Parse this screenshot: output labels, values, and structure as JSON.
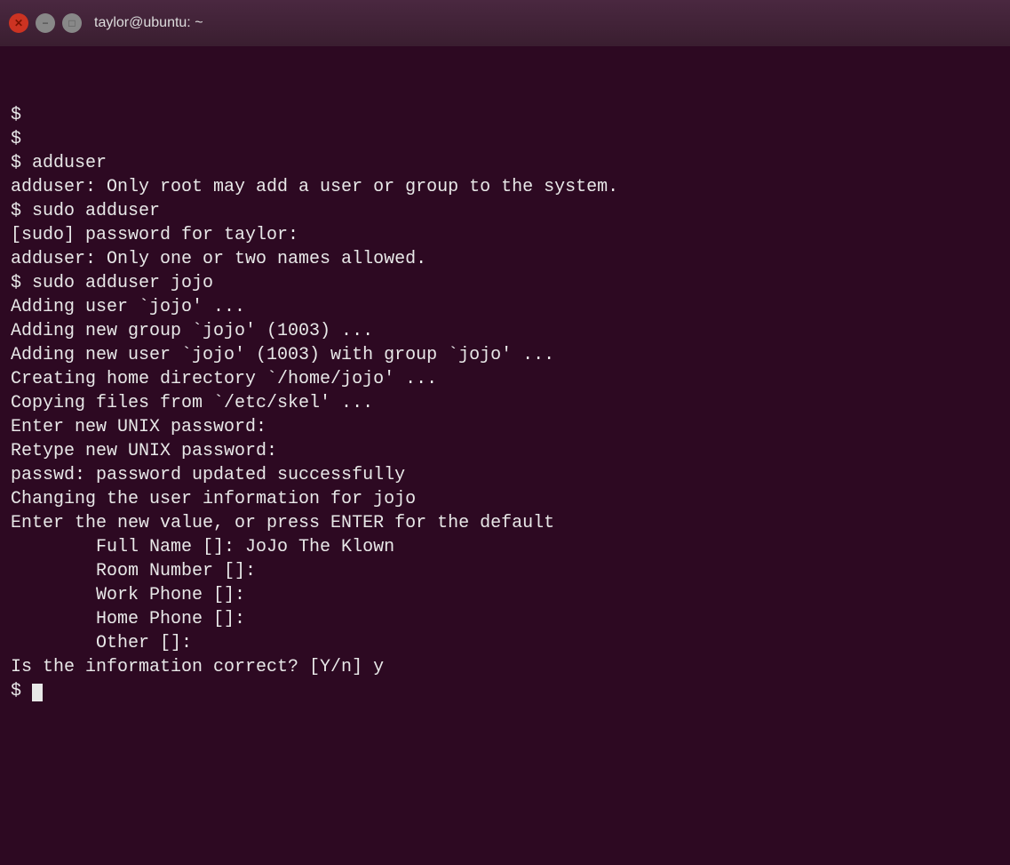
{
  "window": {
    "title": "taylor@ubuntu: ~",
    "buttons": {
      "close": "×",
      "minimize": "−",
      "maximize": "□"
    }
  },
  "terminal": {
    "lines": [
      "$",
      "$",
      "$ adduser",
      "adduser: Only root may add a user or group to the system.",
      "$ sudo adduser",
      "[sudo] password for taylor:",
      "adduser: Only one or two names allowed.",
      "$ sudo adduser jojo",
      "Adding user `jojo' ...",
      "Adding new group `jojo' (1003) ...",
      "Adding new user `jojo' (1003) with group `jojo' ...",
      "Creating home directory `/home/jojo' ...",
      "Copying files from `/etc/skel' ...",
      "Enter new UNIX password:",
      "Retype new UNIX password:",
      "passwd: password updated successfully",
      "Changing the user information for jojo",
      "Enter the new value, or press ENTER for the default",
      "\tFull Name []: JoJo The Klown",
      "\tRoom Number []:",
      "\tWork Phone []:",
      "\tHome Phone []:",
      "\tOther []:",
      "Is the information correct? [Y/n] y",
      "$"
    ]
  }
}
